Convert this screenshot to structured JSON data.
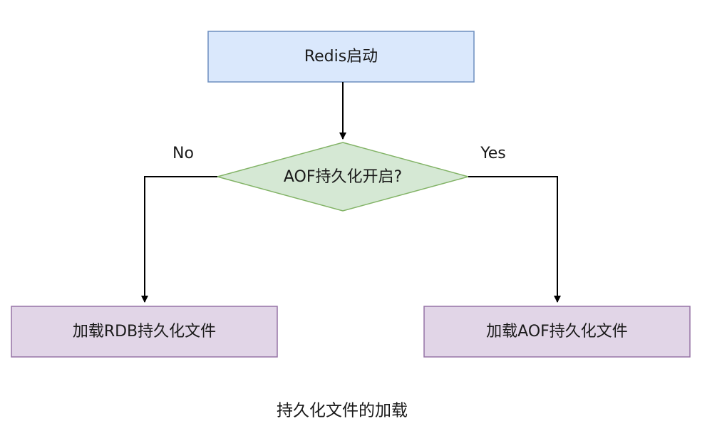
{
  "diagram": {
    "nodes": {
      "start": {
        "label": "Redis启动",
        "fill": "#dae8fc",
        "stroke": "#6c8ebf"
      },
      "decision": {
        "label": "AOF持久化开启?",
        "fill": "#d5e8d4",
        "stroke": "#82b366"
      },
      "load_rdb": {
        "label": "加载RDB持久化文件",
        "fill": "#e1d5e7",
        "stroke": "#9673a6"
      },
      "load_aof": {
        "label": "加载AOF持久化文件",
        "fill": "#e1d5e7",
        "stroke": "#9673a6"
      }
    },
    "edges": {
      "no_label": "No",
      "yes_label": "Yes"
    },
    "caption": "持久化文件的加载"
  }
}
